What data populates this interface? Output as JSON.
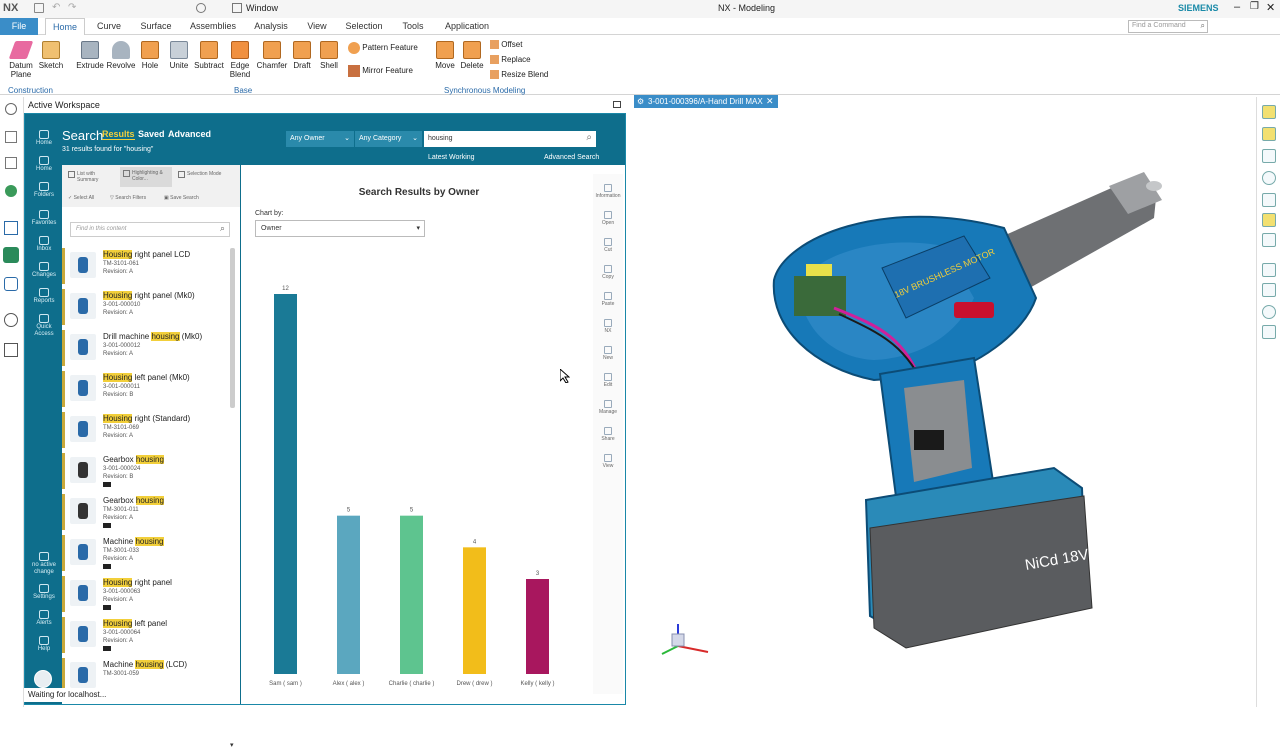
{
  "window": {
    "title": "NX - Modeling",
    "app_logo": "NX",
    "menu_window": "Window",
    "brand": "SIEMENS",
    "find_placeholder": "Find a Command"
  },
  "menus": [
    "File",
    "Home",
    "Curve",
    "Surface",
    "Assemblies",
    "Analysis",
    "View",
    "Selection",
    "Tools",
    "Application"
  ],
  "ribbon": {
    "buttons": [
      "Datum Plane",
      "Sketch",
      "Extrude",
      "Revolve",
      "Hole",
      "Unite",
      "Subtract",
      "Edge Blend",
      "Chamfer",
      "Draft",
      "Shell"
    ],
    "pattern_feature": "Pattern Feature",
    "mirror_feature": "Mirror Feature",
    "move": "Move",
    "delete": "Delete",
    "offset": "Offset",
    "replace": "Replace",
    "resize_blend": "Resize Blend",
    "groups": {
      "construction": "Construction",
      "base": "Base",
      "sync": "Synchronous Modeling"
    }
  },
  "workspace": {
    "title": "Active Workspace"
  },
  "tc_nav": [
    {
      "label": "Home"
    },
    {
      "label": "Home"
    },
    {
      "label": "Folders"
    },
    {
      "label": "Favorites"
    },
    {
      "label": "Inbox"
    },
    {
      "label": "Changes"
    },
    {
      "label": "Reports"
    },
    {
      "label": "Quick Access"
    }
  ],
  "tc_nav_bottom": [
    "no active change",
    "Settings",
    "Alerts",
    "Help"
  ],
  "search": {
    "title": "Search",
    "tabs": [
      "Results",
      "Saved",
      "Advanced"
    ],
    "results_count": "31 results found for \"housing\"",
    "owner_filter": "Any Owner",
    "category_filter": "Any Category",
    "query": "housing",
    "latest_working": "Latest Working",
    "advanced_search": "Advanced Search"
  },
  "toolbar": {
    "list_with_summary": "List with Summary",
    "highlighting": "Highlighting & Color...",
    "selection_mode": "Selection Mode",
    "select_all": "Select All",
    "search_filters": "Search Filters",
    "save_search": "Save Search",
    "find_placeholder": "Find in this content"
  },
  "results": [
    {
      "pre": "",
      "hl": "Housing",
      "post": " right panel LCD",
      "id": "TM-3101-061",
      "rev": "Revision:  A",
      "flag": false
    },
    {
      "pre": "",
      "hl": "Housing",
      "post": " right panel (Mk0)",
      "id": "3-001-000010",
      "rev": "Revision:  A",
      "flag": false
    },
    {
      "pre": "Drill machine ",
      "hl": "housing",
      "post": " (Mk0)",
      "id": "3-001-000012",
      "rev": "Revision:  A",
      "flag": false
    },
    {
      "pre": "",
      "hl": "Housing",
      "post": " left panel (Mk0)",
      "id": "3-001-000011",
      "rev": "Revision:  B",
      "flag": false
    },
    {
      "pre": "",
      "hl": "Housing",
      "post": " right (Standard)",
      "id": "TM-3101-069",
      "rev": "Revision:  A",
      "flag": false
    },
    {
      "pre": "Gearbox ",
      "hl": "housing",
      "post": "",
      "id": "3-001-000024",
      "rev": "Revision:  B",
      "flag": true
    },
    {
      "pre": "Gearbox ",
      "hl": "housing",
      "post": "",
      "id": "TM-3001-011",
      "rev": "Revision:  A",
      "flag": true
    },
    {
      "pre": "Machine ",
      "hl": "housing",
      "post": "",
      "id": "TM-3001-033",
      "rev": "Revision:  A",
      "flag": true
    },
    {
      "pre": "",
      "hl": "Housing",
      "post": " right panel",
      "id": "3-001-000063",
      "rev": "Revision:  A",
      "flag": true
    },
    {
      "pre": "",
      "hl": "Housing",
      "post": " left panel",
      "id": "3-001-000064",
      "rev": "Revision:  A",
      "flag": true
    },
    {
      "pre": "Machine ",
      "hl": "housing",
      "post": " (LCD)",
      "id": "TM-3001-059",
      "rev": "",
      "flag": false
    }
  ],
  "chart_panel": {
    "chart_by_label": "Chart by:",
    "chart_by_value": "Owner"
  },
  "side_tools": [
    "Information",
    "Open",
    "Cut",
    "Copy",
    "Paste",
    "NX",
    "New",
    "Edit",
    "Manage",
    "Share",
    "View"
  ],
  "chart_data": {
    "type": "bar",
    "title": "Search Results by Owner",
    "categories": [
      "Sam ( sam )",
      "Alex ( alex )",
      "Charlie ( charlie )",
      "Drew ( drew )",
      "Kelly ( kelly )"
    ],
    "values": [
      12,
      5,
      5,
      4,
      3
    ],
    "colors": [
      "#1a7a96",
      "#5ba7bf",
      "#5ec48f",
      "#f2bd1a",
      "#a8175e"
    ],
    "ylim": [
      0,
      12
    ],
    "grid": false,
    "legend": "none"
  },
  "viewport": {
    "tab_title": "3-001-000396/A-Hand Drill MAX",
    "motor_label": "18V BRUSHLESS MOTOR",
    "battery_label": "NiCd 18V"
  },
  "status": {
    "text": "Waiting for localhost..."
  }
}
